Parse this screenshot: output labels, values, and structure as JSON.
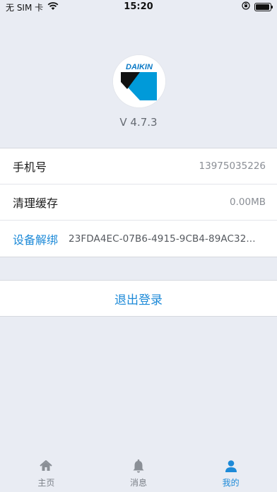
{
  "status_bar": {
    "carrier": "无 SIM 卡",
    "time": "15:20",
    "battery_level": 0.95
  },
  "profile": {
    "logo_text": "DAIKIN",
    "version": "V 4.7.3"
  },
  "settings": {
    "phone": {
      "label": "手机号",
      "value": "13975035226"
    },
    "cache": {
      "label": "清理缓存",
      "value": "0.00MB"
    },
    "unbind": {
      "label": "设备解绑",
      "value": "23FDA4EC-07B6-4915-9CB4-89AC32..."
    }
  },
  "logout_label": "退出登录",
  "tabbar": {
    "home": {
      "label": "主页",
      "icon": "home-icon"
    },
    "messages": {
      "label": "消息",
      "icon": "bell-icon"
    },
    "mine": {
      "label": "我的",
      "icon": "user-icon",
      "active": true
    }
  },
  "colors": {
    "accent": "#1d8ad8",
    "background": "#e9ecf3",
    "logo_blue": "#009ad9"
  }
}
